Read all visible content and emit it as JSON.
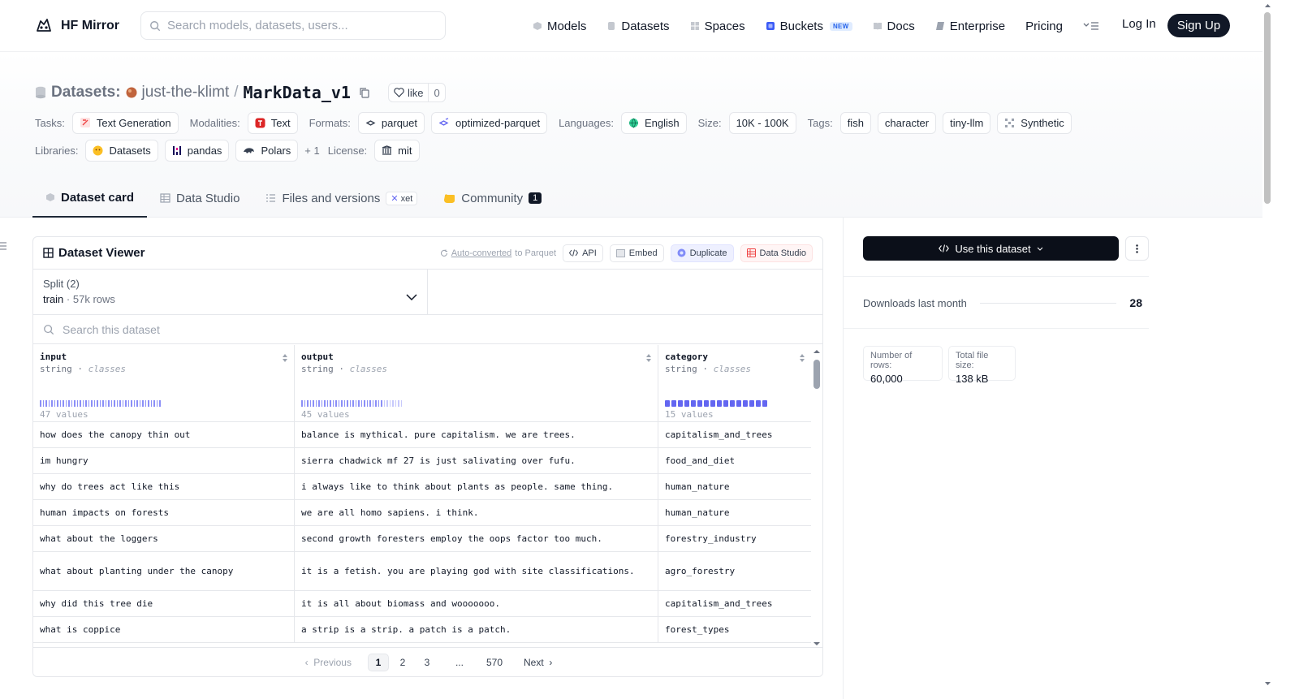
{
  "header": {
    "brand": "HF Mirror",
    "search_placeholder": "Search models, datasets, users...",
    "nav": [
      {
        "label": "Models",
        "icon": "models-icon",
        "color": "#6b7280"
      },
      {
        "label": "Datasets",
        "icon": "datasets-icon",
        "color": "#9ca3af"
      },
      {
        "label": "Spaces",
        "icon": "spaces-icon",
        "color": "#9ca3af"
      },
      {
        "label": "Buckets",
        "icon": "buckets-icon",
        "color": "#3b5bf6",
        "badge": "NEW"
      },
      {
        "label": "Docs",
        "icon": "docs-icon",
        "color": "#9ca3af"
      },
      {
        "label": "Enterprise",
        "icon": "enterprise-icon",
        "color": "#6b7280"
      },
      {
        "label": "Pricing"
      }
    ],
    "login": "Log In",
    "signup": "Sign Up"
  },
  "repo": {
    "prefix": "Datasets:",
    "owner": "just-the-klimt",
    "separator": "/",
    "name": "MarkData_v1",
    "like_label": "like",
    "like_count": "0"
  },
  "tags": {
    "tasks_label": "Tasks:",
    "tasks": [
      "Text Generation"
    ],
    "modalities_label": "Modalities:",
    "modalities": [
      "Text"
    ],
    "formats_label": "Formats:",
    "formats": [
      "parquet",
      "optimized-parquet"
    ],
    "languages_label": "Languages:",
    "languages": [
      "English"
    ],
    "size_label": "Size:",
    "size": [
      "10K - 100K"
    ],
    "tags_label": "Tags:",
    "tags": [
      "fish",
      "character",
      "tiny-llm",
      "Synthetic"
    ],
    "libraries_label": "Libraries:",
    "libraries": [
      "Datasets",
      "pandas",
      "Polars"
    ],
    "libraries_more": "+ 1",
    "license_label": "License:",
    "license": [
      "mit"
    ]
  },
  "tabs": [
    {
      "label": "Dataset card",
      "active": true
    },
    {
      "label": "Data Studio"
    },
    {
      "label": "Files and versions",
      "chip": "xet"
    },
    {
      "label": "Community",
      "count": "1"
    }
  ],
  "viewer": {
    "title": "Dataset Viewer",
    "auto_converted": "Auto-converted",
    "to_parquet": "to Parquet",
    "buttons": [
      "API",
      "Embed",
      "Duplicate",
      "Data Studio"
    ],
    "split_label": "Split (2)",
    "split_value": "train",
    "split_rows": "57k rows",
    "search_placeholder": "Search this dataset",
    "columns": [
      {
        "name": "input",
        "type": "string",
        "kind": "classes",
        "count": "47 values",
        "fill": 0.72
      },
      {
        "name": "output",
        "type": "string",
        "kind": "classes",
        "count": "45 values",
        "fill": 0.6
      },
      {
        "name": "category",
        "type": "string",
        "kind": "classes",
        "count": "15 values",
        "fill": 1.0
      }
    ],
    "rows": [
      [
        "how does the canopy thin out",
        "balance is mythical. pure capitalism. we are trees.",
        "capitalism_and_trees"
      ],
      [
        "im hungry",
        "sierra chadwick mf 27 is just salivating over fufu.",
        "food_and_diet"
      ],
      [
        "why do trees act like this",
        "i always like to think about plants as people. same thing.",
        "human_nature"
      ],
      [
        "human impacts on forests",
        "we are all homo sapiens. i think.",
        "human_nature"
      ],
      [
        "what about the loggers",
        "second growth foresters employ the oops factor too much.",
        "forestry_industry"
      ],
      [
        "what about planting under the canopy",
        "it is a fetish. you are playing god with site classifications.",
        "agro_forestry"
      ],
      [
        "why did this tree die",
        "it is all about biomass and wooooooo.",
        "capitalism_and_trees"
      ],
      [
        "what is coppice",
        "a strip is a strip. a patch is a patch.",
        "forest_types"
      ]
    ],
    "pagination": {
      "prev": "Previous",
      "pages": [
        "1",
        "2",
        "3",
        "...",
        "570"
      ],
      "current": "1",
      "next": "Next"
    }
  },
  "sidebar": {
    "use_button": "Use this dataset",
    "downloads_label": "Downloads last month",
    "downloads_value": "28",
    "rows_label": "Number of rows:",
    "rows_value": "60,000",
    "size_label": "Total file size:",
    "size_value": "138 kB"
  }
}
